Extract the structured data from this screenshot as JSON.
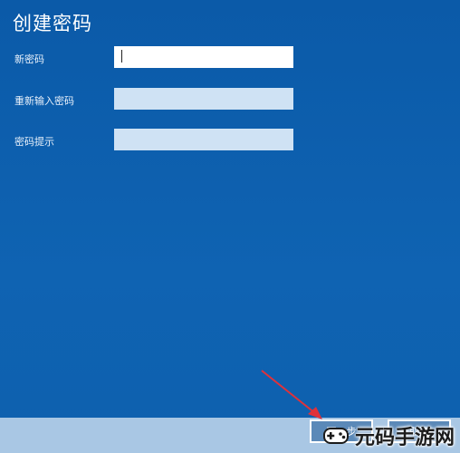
{
  "dialog": {
    "title": "创建密码"
  },
  "fields": [
    {
      "label": "新密码",
      "value": "",
      "placeholder": ""
    },
    {
      "label": "重新输入密码",
      "value": "",
      "placeholder": ""
    },
    {
      "label": "密码提示",
      "value": "",
      "placeholder": ""
    }
  ],
  "buttons": {
    "next_label": "下一步",
    "cancel_label": "取消"
  },
  "watermark": {
    "text": "元码手游网"
  },
  "colors": {
    "background": "#0e5fae",
    "footer": "#a9c7e4",
    "arrow": "#e0323a"
  }
}
